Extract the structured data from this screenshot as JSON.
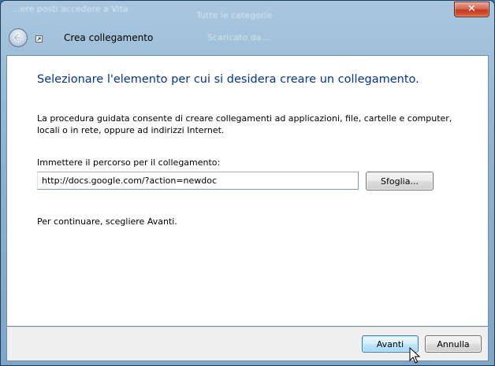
{
  "window": {
    "title": "Crea collegamento",
    "close_label": "✕"
  },
  "background_text": {
    "left": "...ere posti accedere a Vita",
    "right": "Tutte le categorie",
    "right2": "Scaricato da..."
  },
  "wizard": {
    "heading": "Selezionare l'elemento per cui si desidera creare un collegamento.",
    "description": "La procedura guidata consente di creare collegamenti ad applicazioni, file, cartelle e computer, locali o in rete, oppure ad indirizzi Internet.",
    "path_label": "Immettere il percorso per il collegamento:",
    "path_value": "http://docs.google.com/?action=newdoc",
    "browse_label": "Sfoglia...",
    "continue_text": "Per continuare, scegliere Avanti."
  },
  "buttons": {
    "next_label": "Avanti",
    "cancel_label": "Annulla"
  },
  "colors": {
    "heading": "#003399",
    "frame": "#8fb3d1",
    "close": "#c2371b"
  },
  "icons": {
    "back": "back-arrow-icon",
    "wizard": "shortcut-icon",
    "cursor": "mouse-pointer-icon"
  }
}
